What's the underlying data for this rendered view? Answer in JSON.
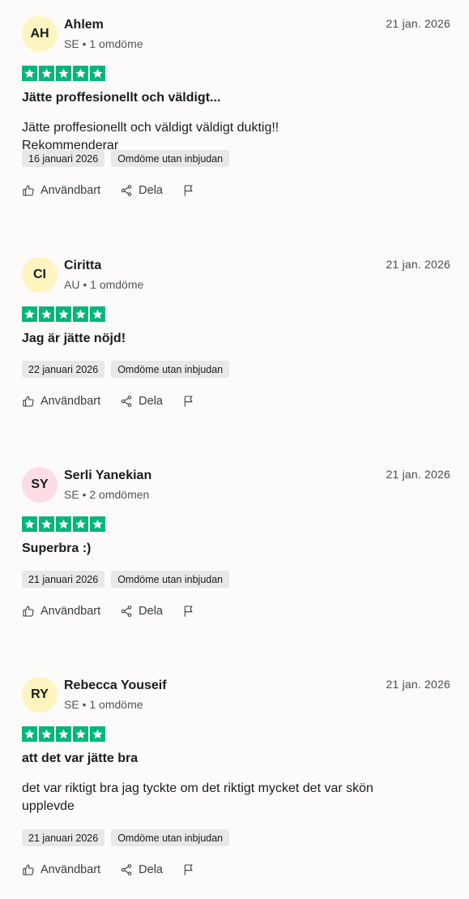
{
  "actions": {
    "useful_label": "Användbart",
    "share_label": "Dela"
  },
  "reviews": [
    {
      "initials": "AH",
      "avatar_color": "#fdf4c0",
      "name": "Ahlem",
      "country": "SE",
      "separator": "•",
      "count": "1 omdöme",
      "date": "21 jan. 2026",
      "rating": 5,
      "title": "Jätte proffesionellt och väldigt...",
      "body": "Jätte proffesionellt och väldigt väldigt duktig!! Rekommenderar",
      "experience_date": "16 januari 2026",
      "invite_tag": "Omdöme utan inbjudan"
    },
    {
      "initials": "CI",
      "avatar_color": "#fdf4c0",
      "name": "Ciritta",
      "country": "AU",
      "separator": "•",
      "count": "1 omdöme",
      "date": "21 jan. 2026",
      "rating": 5,
      "title": "Jag är jätte nöjd!",
      "body": "",
      "experience_date": "22 januari 2026",
      "invite_tag": "Omdöme utan inbjudan"
    },
    {
      "initials": "SY",
      "avatar_color": "#fcdde6",
      "name": "Serli Yanekian",
      "country": "SE",
      "separator": "•",
      "count": "2 omdömen",
      "date": "21 jan. 2026",
      "rating": 5,
      "title": "Superbra :)",
      "body": "",
      "experience_date": "21 januari 2026",
      "invite_tag": "Omdöme utan inbjudan"
    },
    {
      "initials": "RY",
      "avatar_color": "#fdf4c0",
      "name": "Rebecca Youseif",
      "country": "SE",
      "separator": "•",
      "count": "1 omdöme",
      "date": "21 jan. 2026",
      "rating": 5,
      "title": "att det var jätte bra",
      "body": "det var riktigt bra jag tyckte om det riktigt mycket det var skön upplevde",
      "experience_date": "21 januari 2026",
      "invite_tag": "Omdöme utan inbjudan"
    }
  ]
}
